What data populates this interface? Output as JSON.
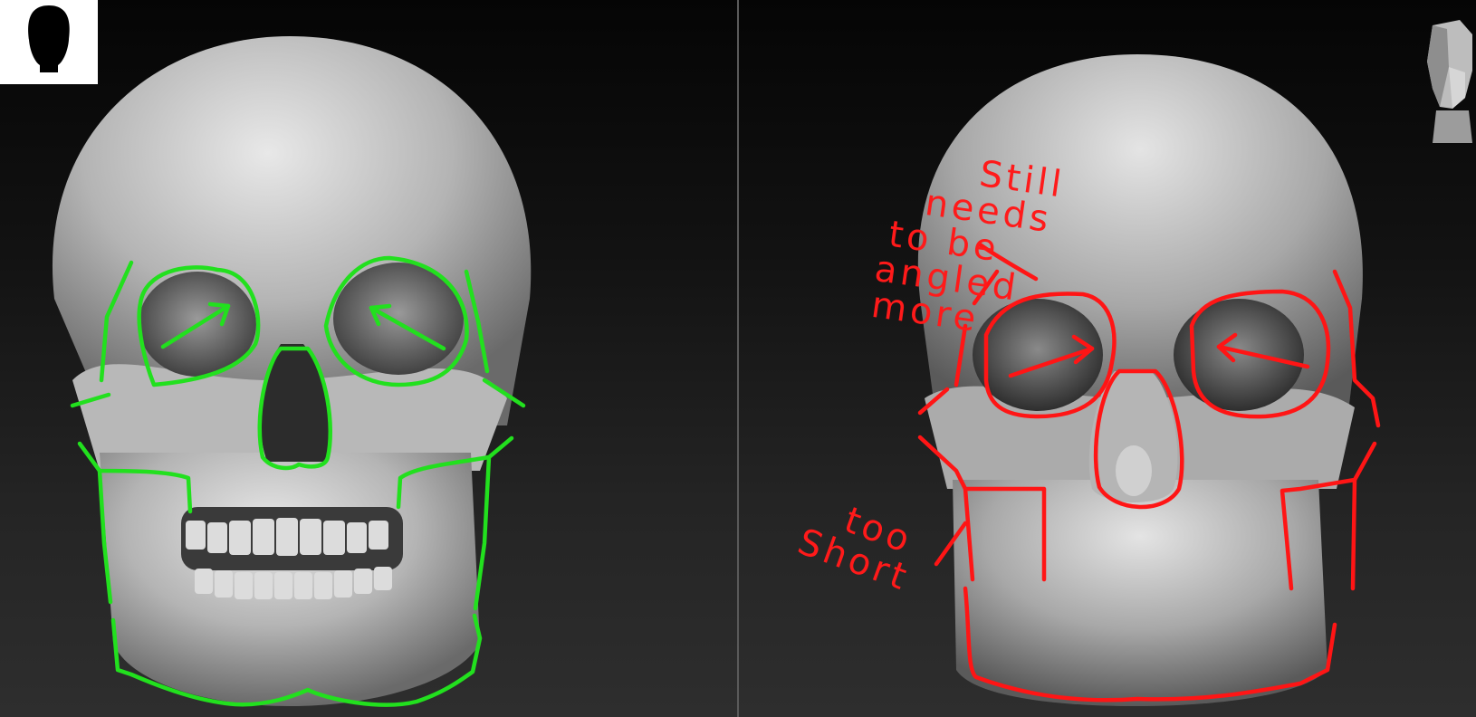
{
  "annotations": {
    "right_note_1": [
      "Still",
      "needs",
      "to be",
      "angled",
      "more"
    ],
    "right_note_2": [
      "too",
      "Short"
    ]
  },
  "colors": {
    "good_overlay": "#22e01e",
    "bad_overlay": "#ff1515",
    "divider": "#5a5a5a"
  },
  "icons": {
    "left_thumbnail": "head-silhouette-icon",
    "right_thumbnail": "planar-head-icon"
  }
}
